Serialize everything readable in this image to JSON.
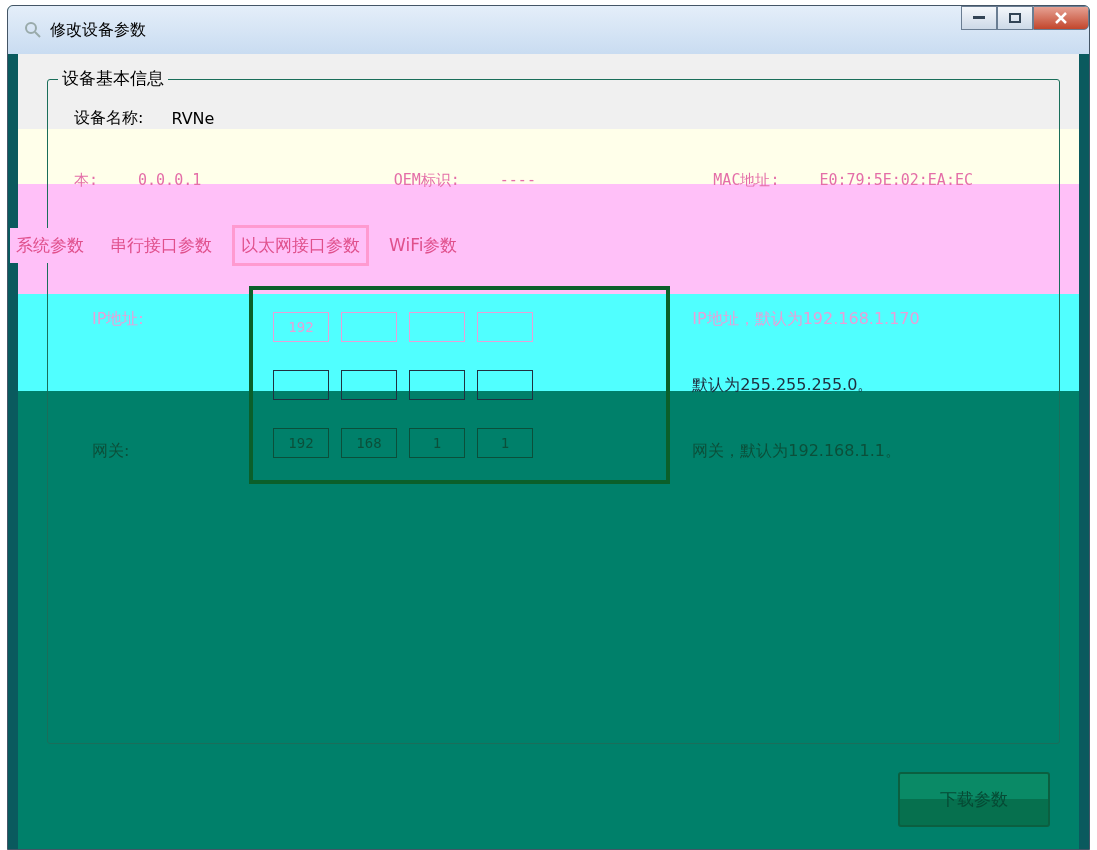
{
  "window": {
    "title": "修改设备参数"
  },
  "device_info": {
    "title": "设备基本信息",
    "name_field": {
      "label": "设备名称:",
      "value": "RVNe"
    },
    "info_fields": [
      {
        "label": "本:",
        "value": "0.0.0.1"
      },
      {
        "label": "OEM标识:",
        "value": "----"
      },
      {
        "label": "MAC地址:",
        "value": "E0:79:5E:02:EA:EC"
      }
    ]
  },
  "tabs": [
    {
      "label": "系统参数",
      "selected": false
    },
    {
      "label": "串行接口参数",
      "selected": false
    },
    {
      "label": "以太网接口参数",
      "selected": true
    },
    {
      "label": "WiFi参数",
      "selected": false
    }
  ],
  "ethernet": {
    "rows": [
      {
        "label": "IP地址:",
        "octets": [
          "192"
        ],
        "hint": "IP地址，默认为192.168.1.170"
      },
      {
        "octets": [],
        "hint": "默认为255.255.255.0。"
      },
      {
        "label": "网关:",
        "octets": [
          "192",
          "168",
          "1",
          "1"
        ],
        "hint": "网关，默认为192.168.1.1。"
      }
    ]
  },
  "buttons": {
    "download": "下载参数"
  }
}
